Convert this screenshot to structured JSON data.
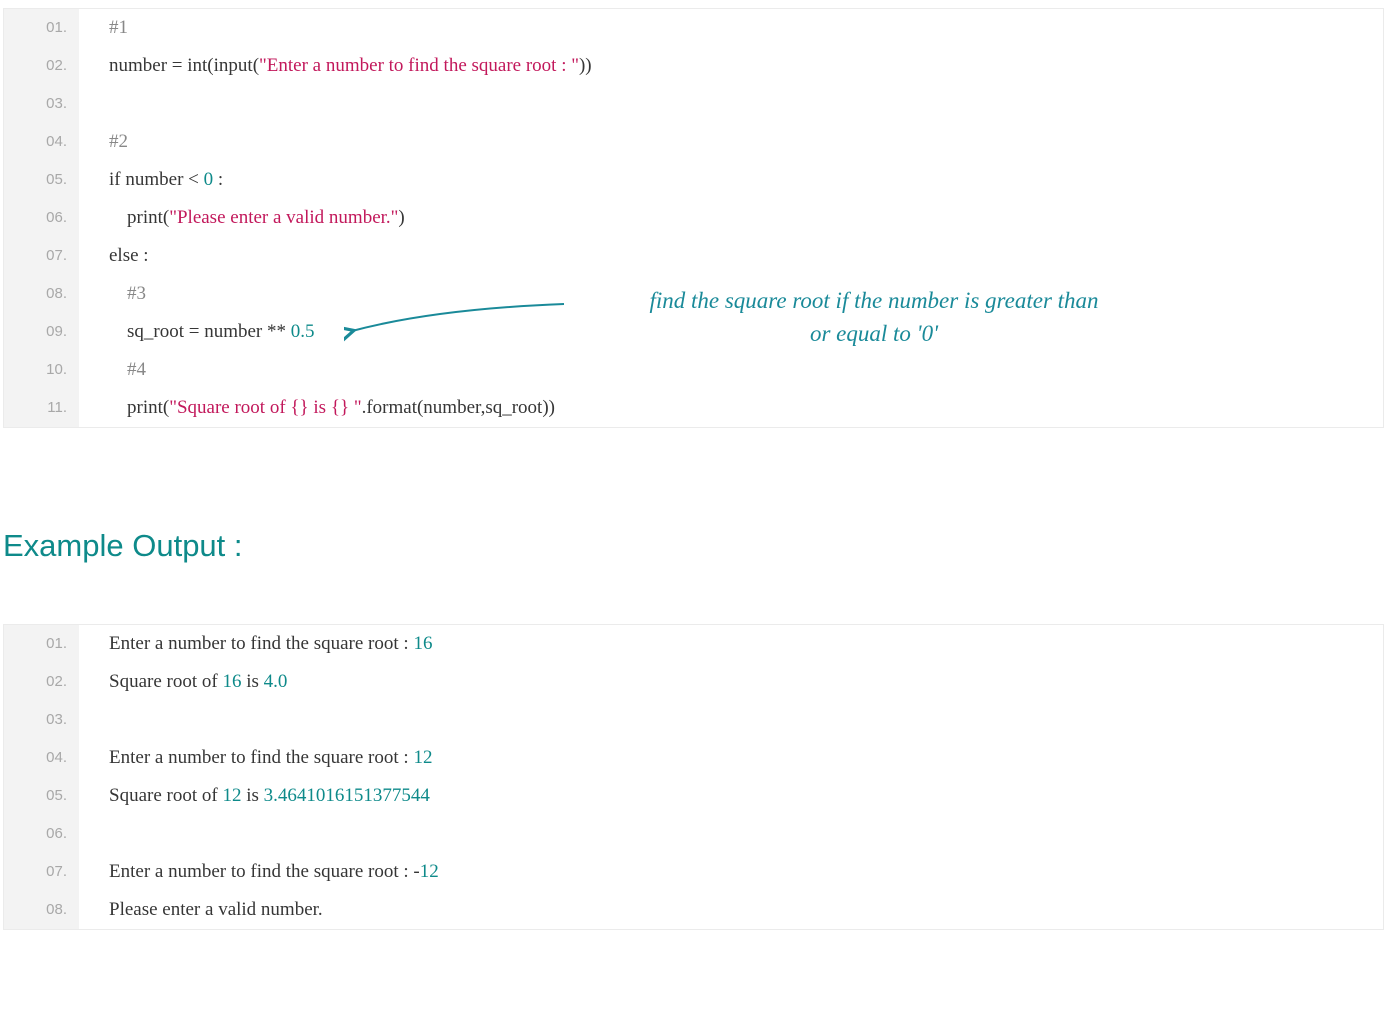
{
  "code1": {
    "lines": [
      {
        "n": "01.",
        "segs": [
          {
            "t": "#1",
            "c": "comment"
          }
        ],
        "indent": 0
      },
      {
        "n": "02.",
        "segs": [
          {
            "t": "number = int(input("
          },
          {
            "t": "\"Enter a number to find the square root : \"",
            "c": "string"
          },
          {
            "t": "))"
          }
        ],
        "indent": 0
      },
      {
        "n": "03.",
        "segs": [],
        "indent": 0
      },
      {
        "n": "04.",
        "segs": [
          {
            "t": "#2",
            "c": "comment"
          }
        ],
        "indent": 0
      },
      {
        "n": "05.",
        "segs": [
          {
            "t": "if number < "
          },
          {
            "t": "0",
            "c": "number"
          },
          {
            "t": " :"
          }
        ],
        "indent": 0
      },
      {
        "n": "06.",
        "segs": [
          {
            "t": "print("
          },
          {
            "t": "\"Please enter a valid number.\"",
            "c": "string"
          },
          {
            "t": ")"
          }
        ],
        "indent": 1
      },
      {
        "n": "07.",
        "segs": [
          {
            "t": "else :"
          }
        ],
        "indent": 0
      },
      {
        "n": "08.",
        "segs": [
          {
            "t": "#3",
            "c": "comment"
          }
        ],
        "indent": 1
      },
      {
        "n": "09.",
        "segs": [
          {
            "t": "sq_root = number ** "
          },
          {
            "t": "0.5",
            "c": "number"
          }
        ],
        "indent": 1
      },
      {
        "n": "10.",
        "segs": [
          {
            "t": "#4",
            "c": "comment"
          }
        ],
        "indent": 1
      },
      {
        "n": "11.",
        "segs": [
          {
            "t": "print("
          },
          {
            "t": "\"Square root of {} is {} \"",
            "c": "string"
          },
          {
            "t": ".format(number,sq_root))"
          }
        ],
        "indent": 1
      }
    ]
  },
  "heading": "Example Output :",
  "annotation": "find the square root if the number is greater than\nor equal to '0'",
  "code2": {
    "lines": [
      {
        "n": "01.",
        "segs": [
          {
            "t": "Enter a number to find the square root : "
          },
          {
            "t": "16",
            "c": "number"
          }
        ],
        "indent": 0
      },
      {
        "n": "02.",
        "segs": [
          {
            "t": "Square root of "
          },
          {
            "t": "16",
            "c": "number"
          },
          {
            "t": " is "
          },
          {
            "t": "4.0",
            "c": "number"
          }
        ],
        "indent": 0
      },
      {
        "n": "03.",
        "segs": [],
        "indent": 0
      },
      {
        "n": "04.",
        "segs": [
          {
            "t": "Enter a number to find the square root : "
          },
          {
            "t": "12",
            "c": "number"
          }
        ],
        "indent": 0
      },
      {
        "n": "05.",
        "segs": [
          {
            "t": "Square root of "
          },
          {
            "t": "12",
            "c": "number"
          },
          {
            "t": " is "
          },
          {
            "t": "3.4641016151377544",
            "c": "number"
          }
        ],
        "indent": 0
      },
      {
        "n": "06.",
        "segs": [],
        "indent": 0
      },
      {
        "n": "07.",
        "segs": [
          {
            "t": "Enter a number to find the square root : -"
          },
          {
            "t": "12",
            "c": "number"
          }
        ],
        "indent": 0
      },
      {
        "n": "08.",
        "segs": [
          {
            "t": "Please enter a valid number."
          }
        ],
        "indent": 0
      }
    ]
  }
}
